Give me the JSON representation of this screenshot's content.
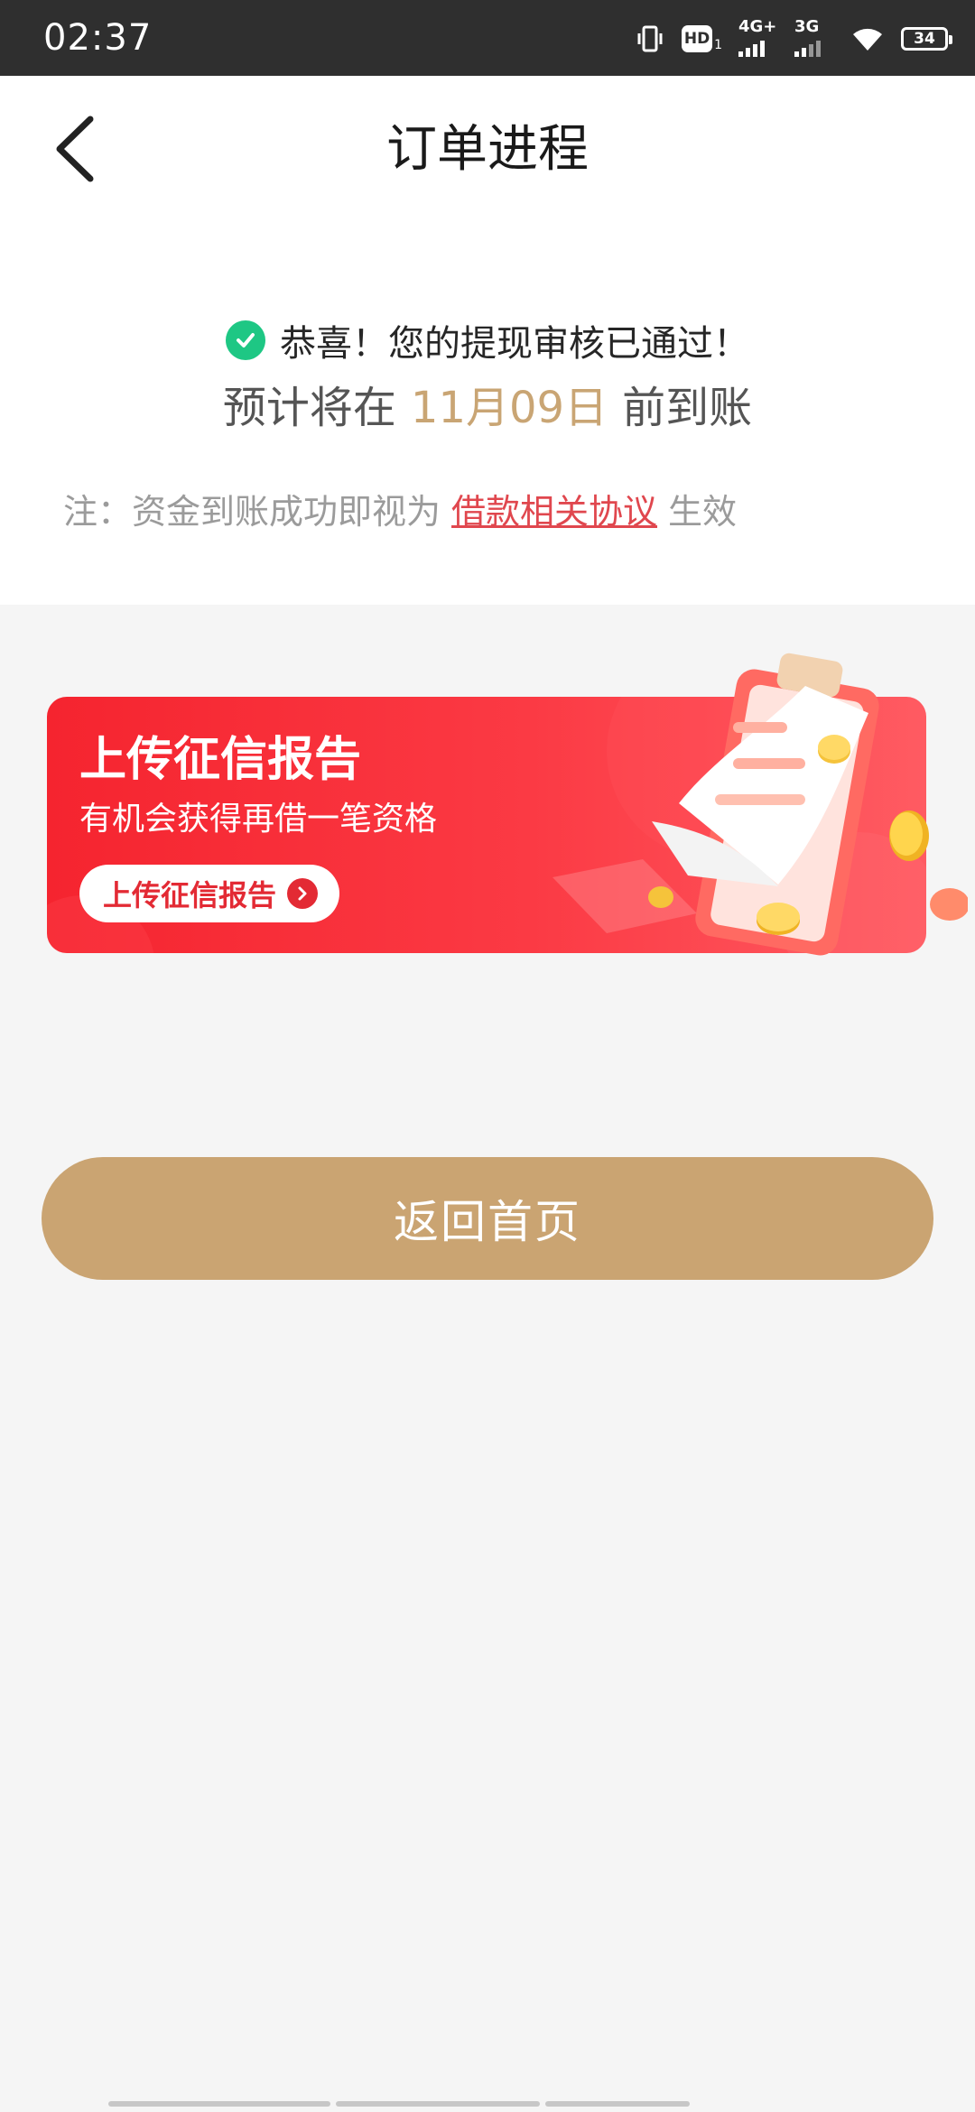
{
  "status_bar": {
    "time": "02:37",
    "hd_label": "HD",
    "hd_sub": "1",
    "network_1": "4G+",
    "network_2": "3G",
    "battery": "34"
  },
  "header": {
    "title": "订单进程"
  },
  "result": {
    "success_text": "恭喜！您的提现审核已通过！",
    "eta_prefix": "预计将在",
    "eta_date": "11月09日",
    "eta_suffix": "前到账",
    "note_prefix": "注：资金到账成功即视为",
    "note_link": "借款相关协议",
    "note_suffix": "生效"
  },
  "banner": {
    "title": "上传征信报告",
    "subtitle": "有机会获得再借一笔资格",
    "button_label": "上传征信报告"
  },
  "home_button": {
    "label": "返回首页"
  },
  "colors": {
    "accent_gold": "#caa472",
    "date_gold": "#c9a574",
    "success_green": "#1ec784",
    "link_red": "#e0474e",
    "banner_red": "#f5242f"
  }
}
